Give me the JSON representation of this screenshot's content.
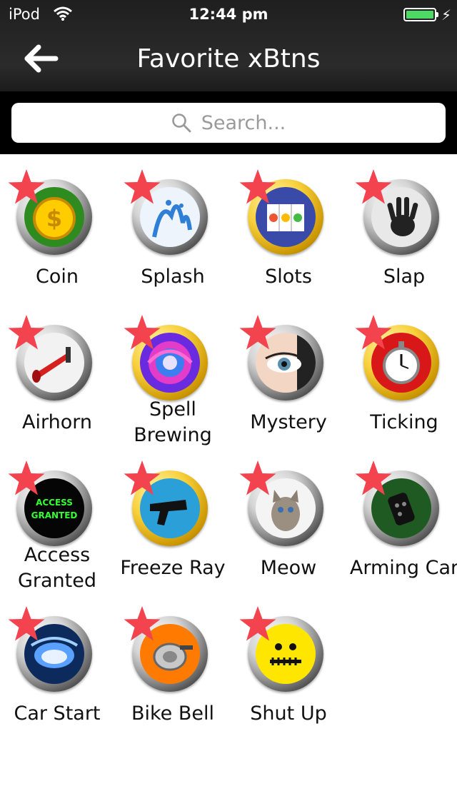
{
  "status_bar": {
    "carrier": "iPod",
    "time": "12:44 pm",
    "battery_color": "#4cd964"
  },
  "nav": {
    "title": "Favorite xBtns",
    "back_icon": "arrow-left-icon"
  },
  "search": {
    "placeholder": "Search...",
    "value": ""
  },
  "colors": {
    "header_bg": "#222222",
    "star": "#f2434f"
  },
  "buttons": [
    {
      "label": "Coin",
      "icon": "coin-icon"
    },
    {
      "label": "Splash",
      "icon": "splash-icon"
    },
    {
      "label": "Slots",
      "icon": "slots-icon"
    },
    {
      "label": "Slap",
      "icon": "handprint-icon"
    },
    {
      "label": "Airhorn",
      "icon": "airhorn-icon"
    },
    {
      "label": "Spell Brewing",
      "icon": "swirl-icon"
    },
    {
      "label": "Mystery",
      "icon": "eye-icon"
    },
    {
      "label": "Ticking",
      "icon": "stopwatch-icon"
    },
    {
      "label": "Access Granted",
      "icon": "access-granted-icon",
      "icon_text": "ACCESS GRANTED"
    },
    {
      "label": "Freeze Ray",
      "icon": "ray-gun-icon"
    },
    {
      "label": "Meow",
      "icon": "kitten-icon"
    },
    {
      "label": "Arming Car",
      "icon": "car-remote-icon"
    },
    {
      "label": "Car Start",
      "icon": "car-start-icon"
    },
    {
      "label": "Bike Bell",
      "icon": "bike-bell-icon"
    },
    {
      "label": "Shut Up",
      "icon": "zipped-smiley-icon"
    }
  ]
}
